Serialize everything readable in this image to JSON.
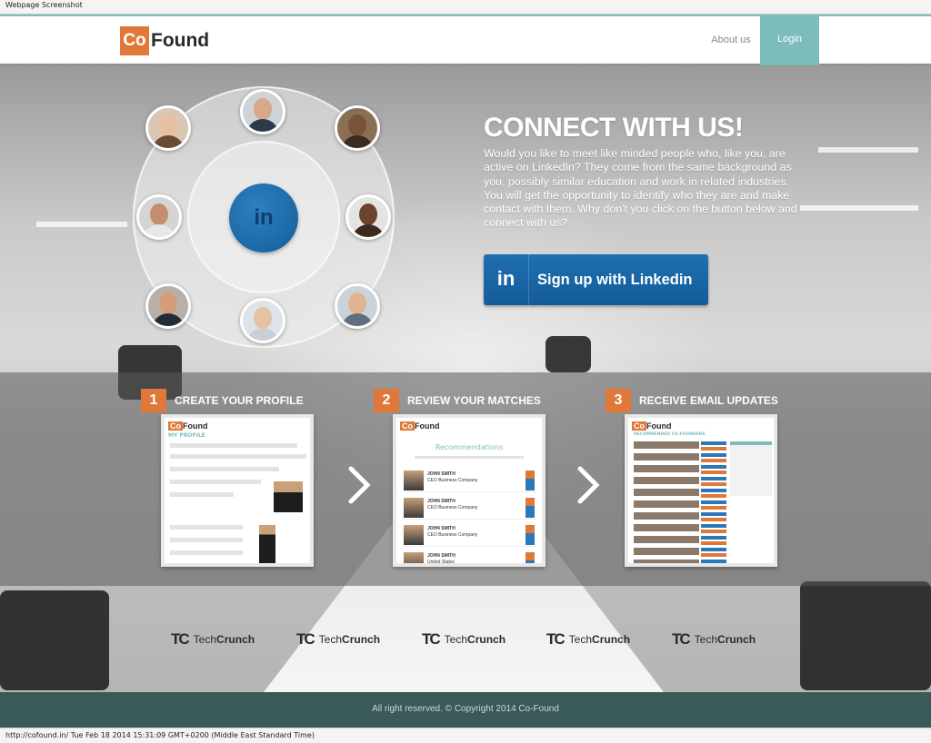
{
  "capture": {
    "top_label": "Webpage Screenshot",
    "bottom_label": "http://cofound.in/ Tue Feb 18 2014 15:31:09 GMT+0200 (Middle East Standard Time)"
  },
  "header": {
    "logo_co": "Co",
    "logo_found": "Found",
    "nav_about": "About us",
    "nav_login": "Login",
    "accent_color": "#7cbdbc",
    "brand_orange": "#e0783a"
  },
  "hero": {
    "center_icon": "linkedin-icon",
    "center_label": "in",
    "title": "CONNECT WITH US!",
    "body": "Would you like to meet like minded people who, like you, are active on LinkedIn? They come from the same background as you, possibly similar education and work in related industries. You will get the opportunity to identify who they are and make contact with them. Why don't you click on the button below and connect with us?",
    "signup_icon_label": "in",
    "signup_label": "Sign up with Linkedin",
    "linkedin_color": "#1a66a8"
  },
  "steps": [
    {
      "number": "1",
      "title": "CREATE YOUR PROFILE",
      "shot_heading": "MY PROFILE"
    },
    {
      "number": "2",
      "title": "REVIEW YOUR MATCHES",
      "shot_heading": "Recommendations"
    },
    {
      "number": "3",
      "title": "RECEIVE EMAIL UPDATES",
      "shot_heading": "RECOMMENDED CO-FOUNDERS"
    }
  ],
  "mini": {
    "logo_co": "Co",
    "logo_found": "Found",
    "match_name": "JOHN SMITH",
    "match_role": "CEO Business Company",
    "match_loc": "United States"
  },
  "press": [
    {
      "mark": "TC",
      "name_a": "Tech",
      "name_b": "Crunch"
    },
    {
      "mark": "TC",
      "name_a": "Tech",
      "name_b": "Crunch"
    },
    {
      "mark": "TC",
      "name_a": "Tech",
      "name_b": "Crunch"
    },
    {
      "mark": "TC",
      "name_a": "Tech",
      "name_b": "Crunch"
    },
    {
      "mark": "TC",
      "name_a": "Tech",
      "name_b": "Crunch"
    }
  ],
  "footer": {
    "copyright": "All right reserved. © Copyright 2014 Co-Found",
    "bg_color": "#3a5a58"
  }
}
